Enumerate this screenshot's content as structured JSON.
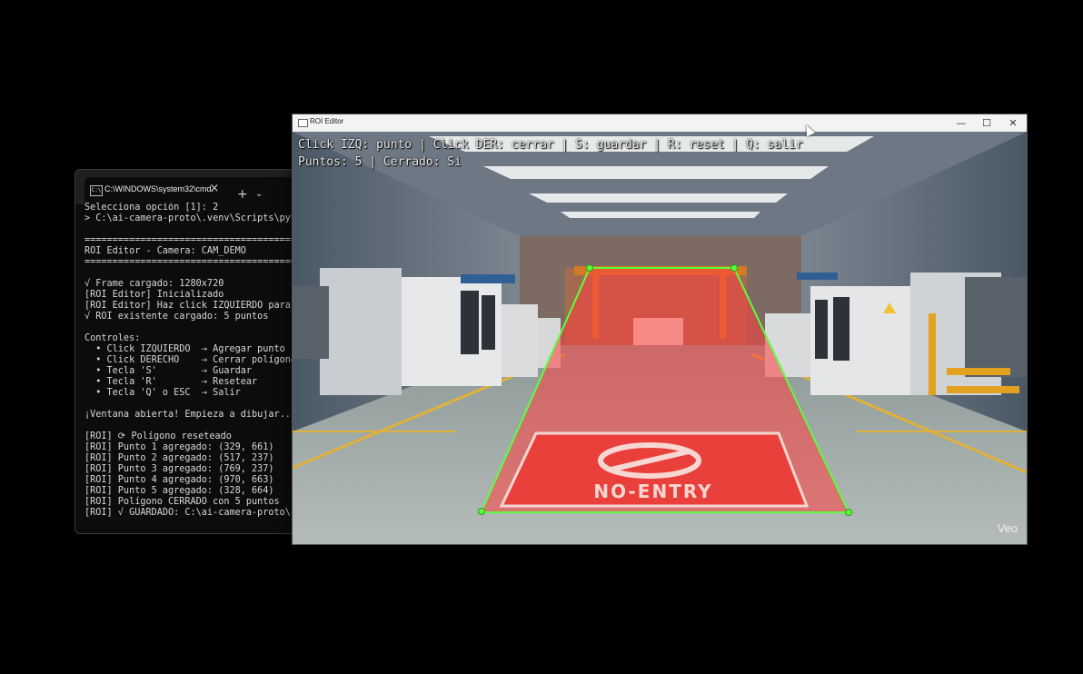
{
  "terminal": {
    "tab_title": "C:\\WINDOWS\\system32\\cmd.",
    "tab_icon": "C:\\",
    "close_icon": "×",
    "new_tab_icon": "+",
    "dropdown_icon": "⌄",
    "lines": [
      "Selecciona opción [1]: 2",
      "> C:\\ai-camera-proto\\.venv\\Scripts\\python",
      "",
      "================================================",
      "ROI Editor - Camera: CAM_DEMO",
      "================================================",
      "",
      "√ Frame cargado: 1280x720",
      "[ROI Editor] Inicializado",
      "[ROI Editor] Haz click IZQUIERDO para ag",
      "√ ROI existente cargado: 5 puntos",
      "",
      "Controles:",
      "  • Click IZQUIERDO  → Agregar punto",
      "  • Click DERECHO    → Cerrar polígono (n",
      "  • Tecla 'S'        → Guardar",
      "  • Tecla 'R'        → Resetear",
      "  • Tecla 'Q' o ESC  → Salir",
      "",
      "¡Ventana abierta! Empieza a dibujar...",
      "",
      "[ROI] ⟳ Polígono reseteado",
      "[ROI] Punto 1 agregado: (329, 661)",
      "[ROI] Punto 2 agregado: (517, 237)",
      "[ROI] Punto 3 agregado: (769, 237)",
      "[ROI] Punto 4 agregado: (970, 663)",
      "[ROI] Punto 5 agregado: (328, 664)",
      "[ROI] Polígono CERRADO con 5 puntos",
      "[ROI] √ GUARDADO: C:\\ai-camera-proto\\con"
    ]
  },
  "roi_window": {
    "title": "ROI Editor",
    "minimize": "—",
    "maximize": "☐",
    "close": "✕",
    "overlay_line1": "Click IZQ: punto | Click DER: cerrar | S: guardar | R: reset | Q: salir",
    "overlay_line2": "Puntos: 5 | Cerrado: Si",
    "floor_sign": "NO-ENTRY",
    "watermark": "Veo",
    "colors": {
      "polygon_edge": "#5dff3a",
      "polygon_fill": "#ff4040"
    }
  }
}
